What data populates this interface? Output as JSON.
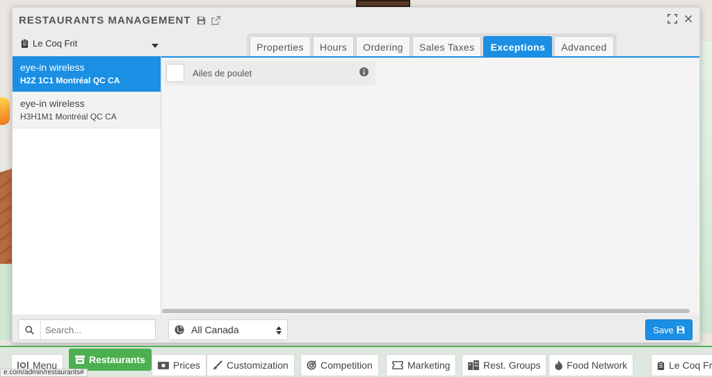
{
  "modal": {
    "title": "RESTAURANTS MANAGEMENT"
  },
  "restaurant_select": {
    "value": "Le Coq Frit"
  },
  "tabs": [
    {
      "label": "Properties",
      "active": false
    },
    {
      "label": "Hours",
      "active": false
    },
    {
      "label": "Ordering",
      "active": false
    },
    {
      "label": "Sales Taxes",
      "active": false
    },
    {
      "label": "Exceptions",
      "active": true
    },
    {
      "label": "Advanced",
      "active": false
    }
  ],
  "locations": [
    {
      "name": "eye-in wireless",
      "address": "H2Z 1C1 Montréal QC CA",
      "active": true
    },
    {
      "name": "eye-in wireless",
      "address": "H3H1M1 Montréal QC CA",
      "active": false
    }
  ],
  "exceptions": [
    {
      "label": "Ailes de poulet",
      "checked": false
    }
  ],
  "search": {
    "placeholder": "Search..."
  },
  "region": {
    "value": "All Canada"
  },
  "save_label": "Save",
  "bottom_nav": [
    {
      "label": "Menu",
      "icon": "utensils-icon"
    },
    {
      "label": "Restaurants",
      "icon": "store-icon",
      "active": true
    },
    {
      "label": "Prices",
      "icon": "money-icon"
    },
    {
      "label": "Customization",
      "icon": "brush-icon"
    },
    {
      "label": "Competition",
      "icon": "target-icon"
    },
    {
      "label": "Marketing",
      "icon": "ticket-icon"
    },
    {
      "label": "Rest. Groups",
      "icon": "building-icon"
    },
    {
      "label": "Food Network",
      "icon": "fire-icon"
    },
    {
      "label": "Le Coq Frit",
      "icon": "clipboard-icon"
    }
  ],
  "status_url": "e.com/admin/restaurants#",
  "colors": {
    "accent_blue": "#1a8fe3",
    "accent_green": "#4cb050"
  }
}
